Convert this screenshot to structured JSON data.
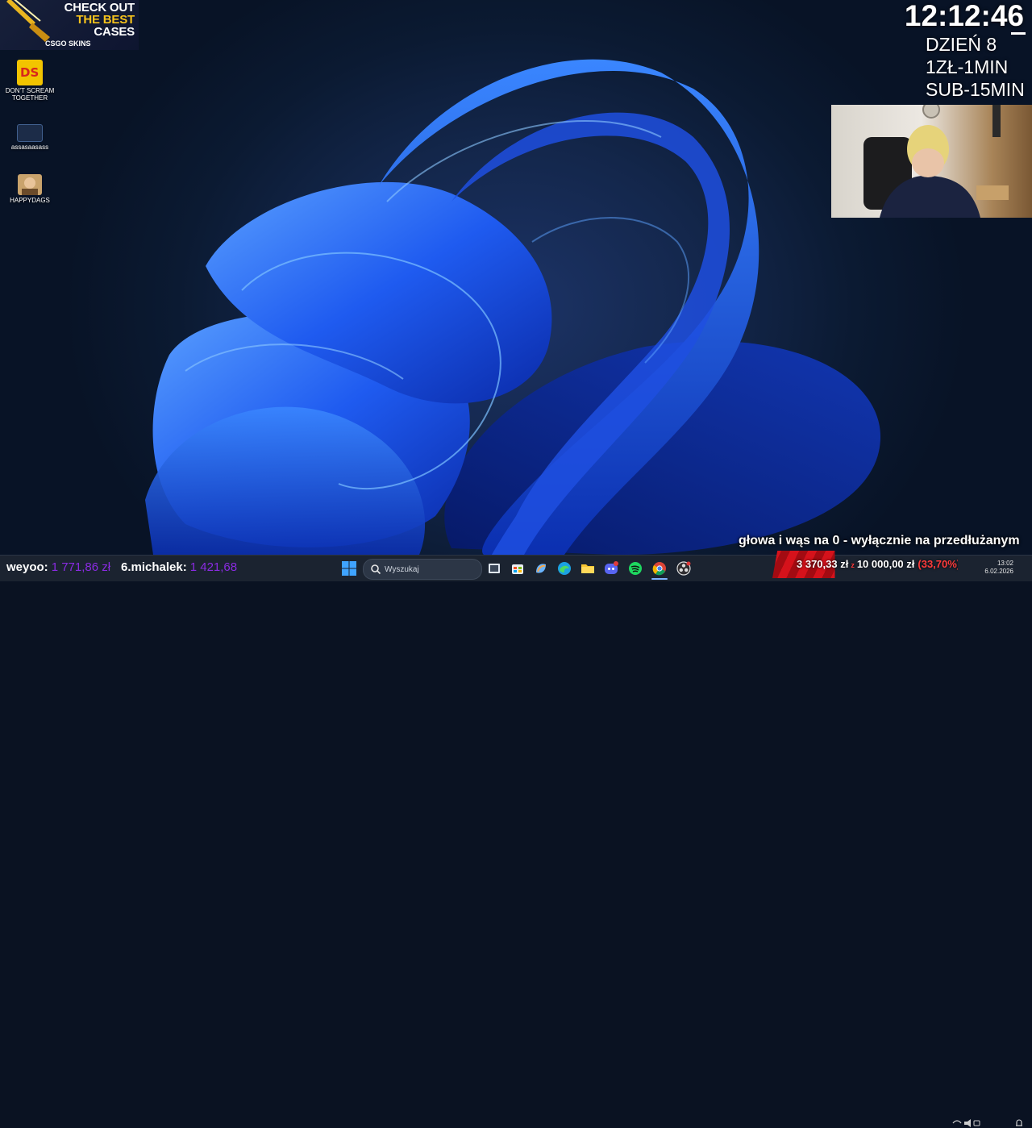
{
  "promo": {
    "line1": "CHECK OUT",
    "line2": "THE BEST",
    "line3": "CASES",
    "brand": "CSGO SKINS"
  },
  "desktop_icons": [
    {
      "label": "DON'T SCREAM TOGETHER",
      "glyph": "DS"
    },
    {
      "label": "assasaasass"
    },
    {
      "label": "HAPPYDAGS"
    }
  ],
  "overlay": {
    "clock": "12:12:46",
    "day": "DZIEŃ 8",
    "rate1": "1ZŁ-1MIN",
    "rate2": "SUB-15MIN"
  },
  "ticker": "głowa i wąs na 0 - wyłącznie na przedłużanym",
  "taskbar": {
    "donors": [
      {
        "name": "weyoo:",
        "amount": "1 771,86 zł"
      },
      {
        "name": "6.michalek:",
        "amount": "1 421,68"
      }
    ],
    "search_placeholder": "Wyszukaj",
    "apps": [
      "task-view-icon",
      "store-icon",
      "copilot-icon",
      "edge-icon",
      "file-explorer-icon",
      "discord-icon",
      "spotify-icon",
      "chrome-icon",
      "obs-icon"
    ],
    "progress": {
      "current": "3 370,33 zł",
      "separator": "z",
      "goal": "10 000,00 zł",
      "percent": "(33,70%)",
      "fraction": 0.337
    },
    "tray_time": "13:02",
    "tray_date": "6.02.2026"
  },
  "colors": {
    "taskbar": "#1b2330",
    "donor_amount": "#8a2be2",
    "promo_accent": "#f7c31c",
    "progress_red": "#d5121b"
  }
}
